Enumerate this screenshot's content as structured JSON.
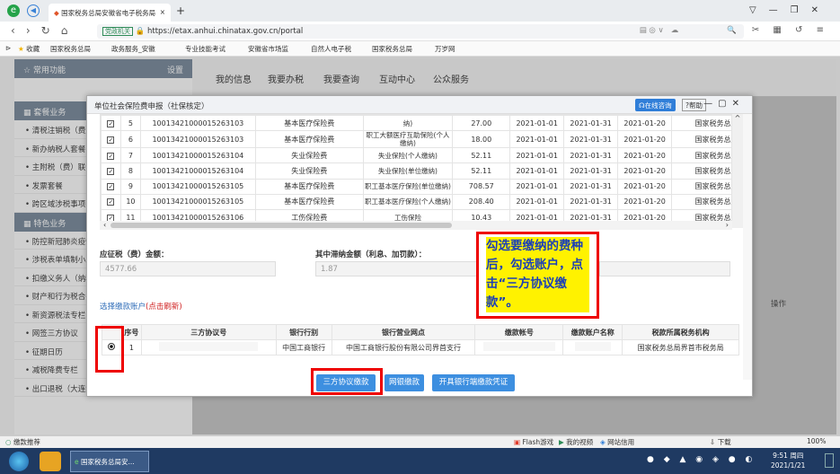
{
  "browser": {
    "tab_title": "国家税务总局安徽省电子税务局",
    "new_tab": "+",
    "address_prefix": "党政机关",
    "url": "https://etax.anhui.chinatax.gov.cn/portal",
    "window_controls": [
      "▽",
      "—",
      "❐",
      "✕"
    ],
    "nav_icons": [
      "‹",
      "›",
      "↻",
      "⌂"
    ],
    "favorites": [
      "收藏",
      "国家税务总局",
      "政务服务_安徽",
      "专业技能考试",
      "安徽省市场监",
      "自然人电子税",
      "国家税务总局",
      "万岁网"
    ]
  },
  "sidebar": {
    "header": "常用功能",
    "header_action": "设置",
    "section1": "套餐业务",
    "items1": [
      "清税注销税（费）",
      "新办纳税人套餐",
      "主附税（费）联合",
      "发票套餐",
      "跨区域涉税事项"
    ],
    "section2": "特色业务",
    "items2": [
      "防控新冠肺炎疫情",
      "涉税表单填制小助",
      "扣缴义务人（纳税",
      "财产和行为税合并",
      "新资源税法专栏",
      "网签三方协议",
      "征期日历",
      "减税降费专栏",
      "出口退税（大连龙图版）"
    ]
  },
  "topmenu": [
    "我的信息",
    "我要办税",
    "我要查询",
    "互动中心",
    "公众服务"
  ],
  "modal": {
    "title": "单位社会保险费申报（社保核定）",
    "online_help": "在线咨询",
    "help": "帮助",
    "rows": [
      {
        "no": "5",
        "id": "10013421000015263103",
        "type": "基本医疗保险费",
        "item": "纳)",
        "amount": "27.00",
        "start": "2021-01-01",
        "end": "2021-01-31",
        "due": "2021-01-20",
        "org": "国家税务总局界首市"
      },
      {
        "no": "6",
        "id": "10013421000015263103",
        "type": "基本医疗保险费",
        "item": "职工大额医疗互助保险(个人缴纳)",
        "amount": "18.00",
        "start": "2021-01-01",
        "end": "2021-01-31",
        "due": "2021-01-20",
        "org": "国家税务总局界首市"
      },
      {
        "no": "7",
        "id": "10013421000015263104",
        "type": "失业保险费",
        "item": "失业保险(个人缴纳)",
        "amount": "52.11",
        "start": "2021-01-01",
        "end": "2021-01-31",
        "due": "2021-01-20",
        "org": "国家税务总局界首市"
      },
      {
        "no": "8",
        "id": "10013421000015263104",
        "type": "失业保险费",
        "item": "失业保险(单位缴纳)",
        "amount": "52.11",
        "start": "2021-01-01",
        "end": "2021-01-31",
        "due": "2021-01-20",
        "org": "国家税务总局界首市"
      },
      {
        "no": "9",
        "id": "10013421000015263105",
        "type": "基本医疗保险费",
        "item": "职工基本医疗保险(单位缴纳)",
        "amount": "708.57",
        "start": "2021-01-01",
        "end": "2021-01-31",
        "due": "2021-01-20",
        "org": "国家税务总局界首市"
      },
      {
        "no": "10",
        "id": "10013421000015263105",
        "type": "基本医疗保险费",
        "item": "职工基本医疗保险(个人缴纳)",
        "amount": "208.40",
        "start": "2021-01-01",
        "end": "2021-01-31",
        "due": "2021-01-20",
        "org": "国家税务总局界首市"
      },
      {
        "no": "11",
        "id": "10013421000015263106",
        "type": "工伤保险费",
        "item": "工伤保险",
        "amount": "10.43",
        "start": "2021-01-01",
        "end": "2021-01-31",
        "due": "2021-01-20",
        "org": "国家税务总局界首市"
      }
    ],
    "payable_label": "应征税（费）金额：",
    "payable_value": "4577.66",
    "late_label": "其中滞纳金额（利息、加罚款）：",
    "late_value": "1.87",
    "account_section": "选择缴款账户",
    "refresh": "(点击刷新)",
    "account_headers": [
      "序号",
      "三方协议号",
      "银行行别",
      "银行营业网点",
      "缴款帐号",
      "缴款账户名称",
      "税款所属税务机构"
    ],
    "account_row": {
      "no": "1",
      "bank": "中国工商银行",
      "branch": "中国工商银行股份有限公司界首支行",
      "tax_org": "国家税务总局界首市税务局"
    },
    "buttons": [
      "三方协议缴款",
      "网银缴款",
      "开具银行端缴款凭证"
    ]
  },
  "behind_column": "操作",
  "annotation": "勾选要缴纳的费种后，勾选账户，点击“三方协议缴款”。",
  "status": {
    "left": "缴款推荐",
    "items": [
      "Flash游戏",
      "我的视频",
      "网站信用",
      "下载"
    ],
    "zoom": "100%"
  },
  "taskbar": {
    "app": "国家税务总局安...",
    "time": "9:51 周四",
    "date": "2021/1/21"
  }
}
